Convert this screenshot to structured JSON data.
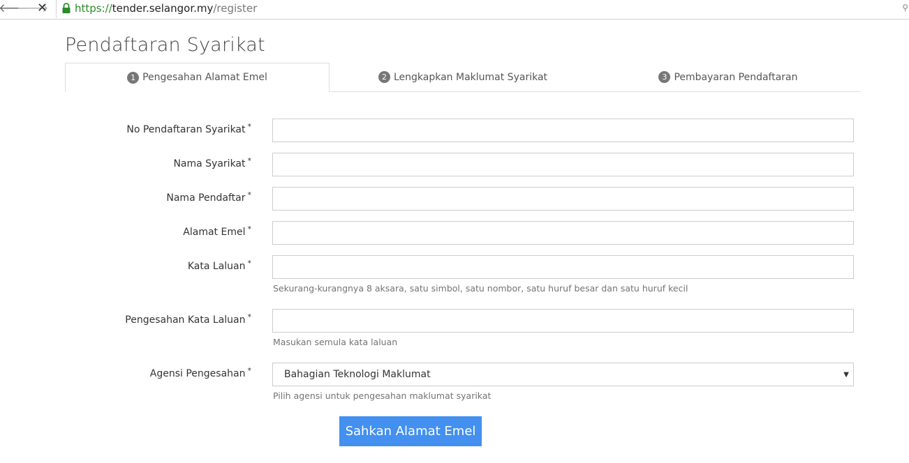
{
  "browser": {
    "url_scheme": "https://",
    "url_host": "tender.selangor.my",
    "url_path": "/register"
  },
  "page": {
    "title": "Pendaftaran Syarikat"
  },
  "tabs": [
    {
      "num": "1",
      "label": "Pengesahan Alamat Emel",
      "active": true
    },
    {
      "num": "2",
      "label": "Lengkapkan Maklumat Syarikat",
      "active": false
    },
    {
      "num": "3",
      "label": "Pembayaran Pendaftaran",
      "active": false
    }
  ],
  "form": {
    "required_mark": "*",
    "fields": {
      "reg_no": {
        "label": "No Pendaftaran Syarikat",
        "value": ""
      },
      "company_name": {
        "label": "Nama Syarikat",
        "value": ""
      },
      "registrant_name": {
        "label": "Nama Pendaftar",
        "value": ""
      },
      "email": {
        "label": "Alamat Emel",
        "value": ""
      },
      "password": {
        "label": "Kata Laluan",
        "value": "",
        "help": "Sekurang-kurangnya 8 aksara, satu simbol, satu nombor, satu huruf besar dan satu huruf kecil"
      },
      "password_confirm": {
        "label": "Pengesahan Kata Laluan",
        "value": "",
        "help": "Masukan semula kata laluan"
      },
      "agency": {
        "label": "Agensi Pengesahan",
        "selected": "Bahagian Teknologi Maklumat",
        "help": "Pilih agensi untuk pengesahan maklumat syarikat"
      }
    },
    "submit_label": "Sahkan Alamat Emel"
  },
  "colors": {
    "accent": "#4390f0",
    "secure_green": "#2b8a2b"
  },
  "icons": {
    "back": "back-arrow-icon",
    "forward": "forward-arrow-icon",
    "stop": "close-icon",
    "lock": "lock-icon",
    "extension": "extension-icon",
    "caret": "chevron-down-icon"
  }
}
